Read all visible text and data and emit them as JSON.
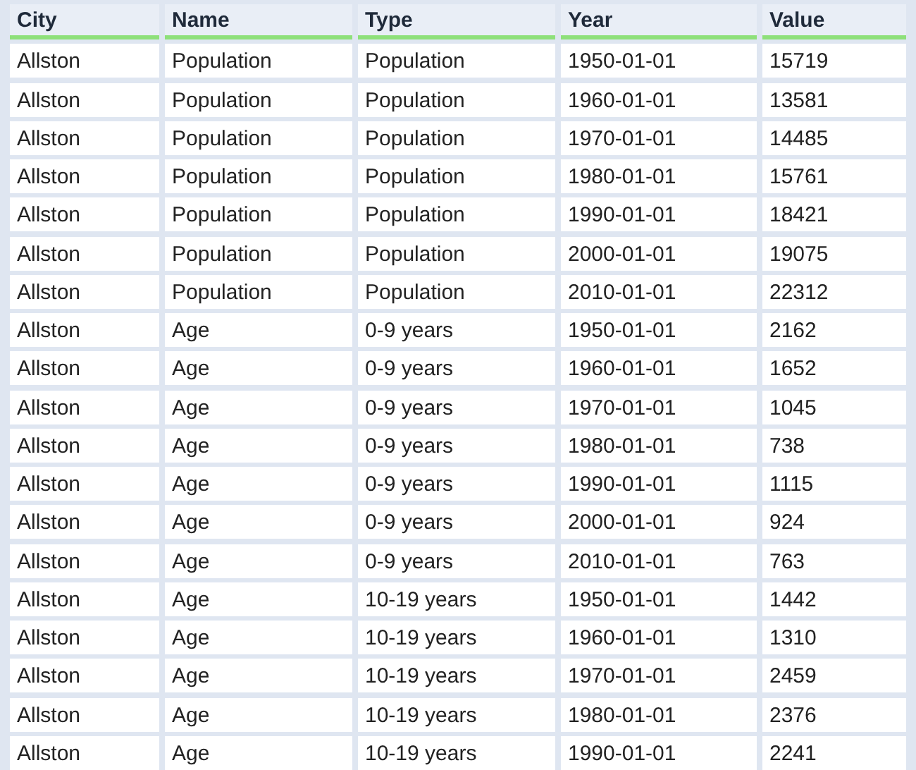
{
  "table": {
    "columns": [
      "City",
      "Name",
      "Type",
      "Year",
      "Value"
    ],
    "rows": [
      [
        "Allston",
        "Population",
        "Population",
        "1950-01-01",
        "15719"
      ],
      [
        "Allston",
        "Population",
        "Population",
        "1960-01-01",
        "13581"
      ],
      [
        "Allston",
        "Population",
        "Population",
        "1970-01-01",
        "14485"
      ],
      [
        "Allston",
        "Population",
        "Population",
        "1980-01-01",
        "15761"
      ],
      [
        "Allston",
        "Population",
        "Population",
        "1990-01-01",
        "18421"
      ],
      [
        "Allston",
        "Population",
        "Population",
        "2000-01-01",
        "19075"
      ],
      [
        "Allston",
        "Population",
        "Population",
        "2010-01-01",
        "22312"
      ],
      [
        "Allston",
        "Age",
        "0-9 years",
        "1950-01-01",
        "2162"
      ],
      [
        "Allston",
        "Age",
        "0-9 years",
        "1960-01-01",
        "1652"
      ],
      [
        "Allston",
        "Age",
        "0-9 years",
        "1970-01-01",
        "1045"
      ],
      [
        "Allston",
        "Age",
        "0-9 years",
        "1980-01-01",
        "738"
      ],
      [
        "Allston",
        "Age",
        "0-9 years",
        "1990-01-01",
        "1115"
      ],
      [
        "Allston",
        "Age",
        "0-9 years",
        "2000-01-01",
        "924"
      ],
      [
        "Allston",
        "Age",
        "0-9 years",
        "2010-01-01",
        "763"
      ],
      [
        "Allston",
        "Age",
        "10-19 years",
        "1950-01-01",
        "1442"
      ],
      [
        "Allston",
        "Age",
        "10-19 years",
        "1960-01-01",
        "1310"
      ],
      [
        "Allston",
        "Age",
        "10-19 years",
        "1970-01-01",
        "2459"
      ],
      [
        "Allston",
        "Age",
        "10-19 years",
        "1980-01-01",
        "2376"
      ],
      [
        "Allston",
        "Age",
        "10-19 years",
        "1990-01-01",
        "2241"
      ]
    ]
  }
}
